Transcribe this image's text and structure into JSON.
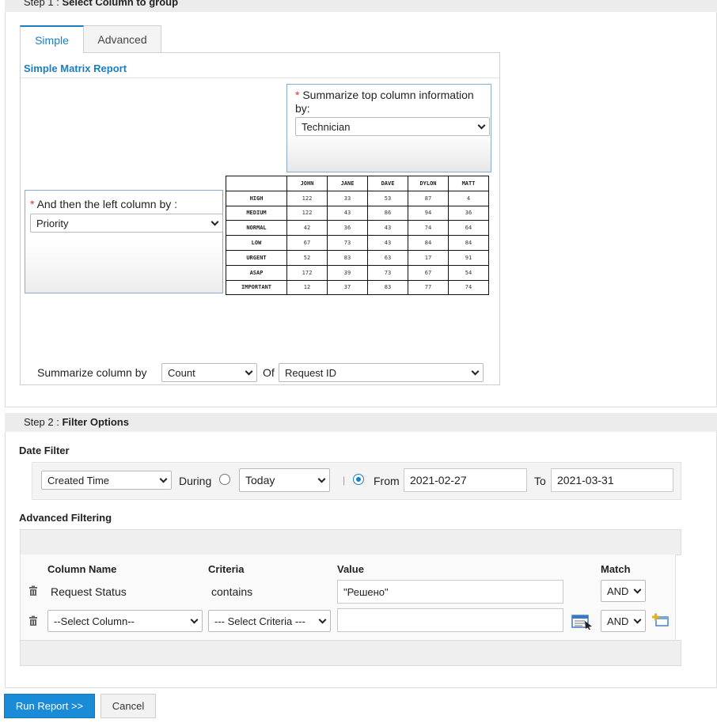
{
  "step1": {
    "prefix": "Step 1",
    "sep": " : ",
    "title": "Select Column to group"
  },
  "tabs": [
    {
      "label": "Simple",
      "active": true
    },
    {
      "label": "Advanced",
      "active": false
    }
  ],
  "simple": {
    "title": "Simple Matrix Report",
    "top_label": "Summarize top column information by:",
    "top_value": "Technician",
    "left_label": "And then the left column by :",
    "left_value": "Priority",
    "summarize_label": "Summarize column by",
    "summarize_value": "Count",
    "of_label": "Of",
    "of_value": "Request ID"
  },
  "matrix": {
    "columns": [
      "JOHN",
      "JANE",
      "DAVE",
      "DYLON",
      "MATT"
    ],
    "rows": [
      {
        "label": "HIGH",
        "values": [
          "122",
          "33",
          "53",
          "87",
          "4"
        ]
      },
      {
        "label": "MEDIUM",
        "values": [
          "122",
          "43",
          "86",
          "94",
          "36"
        ]
      },
      {
        "label": "NORMAL",
        "values": [
          "42",
          "36",
          "43",
          "74",
          "64"
        ]
      },
      {
        "label": "LOW",
        "values": [
          "67",
          "73",
          "43",
          "84",
          "84"
        ]
      },
      {
        "label": "URGENT",
        "values": [
          "52",
          "83",
          "63",
          "17",
          "91"
        ]
      },
      {
        "label": "ASAP",
        "values": [
          "172",
          "39",
          "73",
          "67",
          "54"
        ]
      },
      {
        "label": "IMPORTANT",
        "values": [
          "12",
          "37",
          "83",
          "77",
          "74"
        ]
      }
    ]
  },
  "step2": {
    "prefix": "Step 2",
    "sep": " : ",
    "title": "Filter Options"
  },
  "date_filter": {
    "title": "Date Filter",
    "column_value": "Created Time",
    "during_label": "During",
    "during_value": "Today",
    "sep": "|",
    "from_label": "From",
    "from_value": "2021-02-27",
    "to_label": "To",
    "to_value": "2021-03-31"
  },
  "advanced": {
    "title": "Advanced Filtering",
    "headers": {
      "column": "Column Name",
      "criteria": "Criteria",
      "value": "Value",
      "match": "Match"
    },
    "row1": {
      "column": "Request Status",
      "criteria": "contains",
      "value": "\"Решено\"",
      "match": "AND"
    },
    "row2": {
      "column": "--Select Column--",
      "criteria": "--- Select Criteria ---",
      "value": "",
      "match": "AND"
    }
  },
  "buttons": {
    "run": "Run Report >>",
    "cancel": "Cancel"
  },
  "colors": {
    "accent": "#1a7fc2",
    "button": "#1a8bd6",
    "required": "#dd3333"
  }
}
